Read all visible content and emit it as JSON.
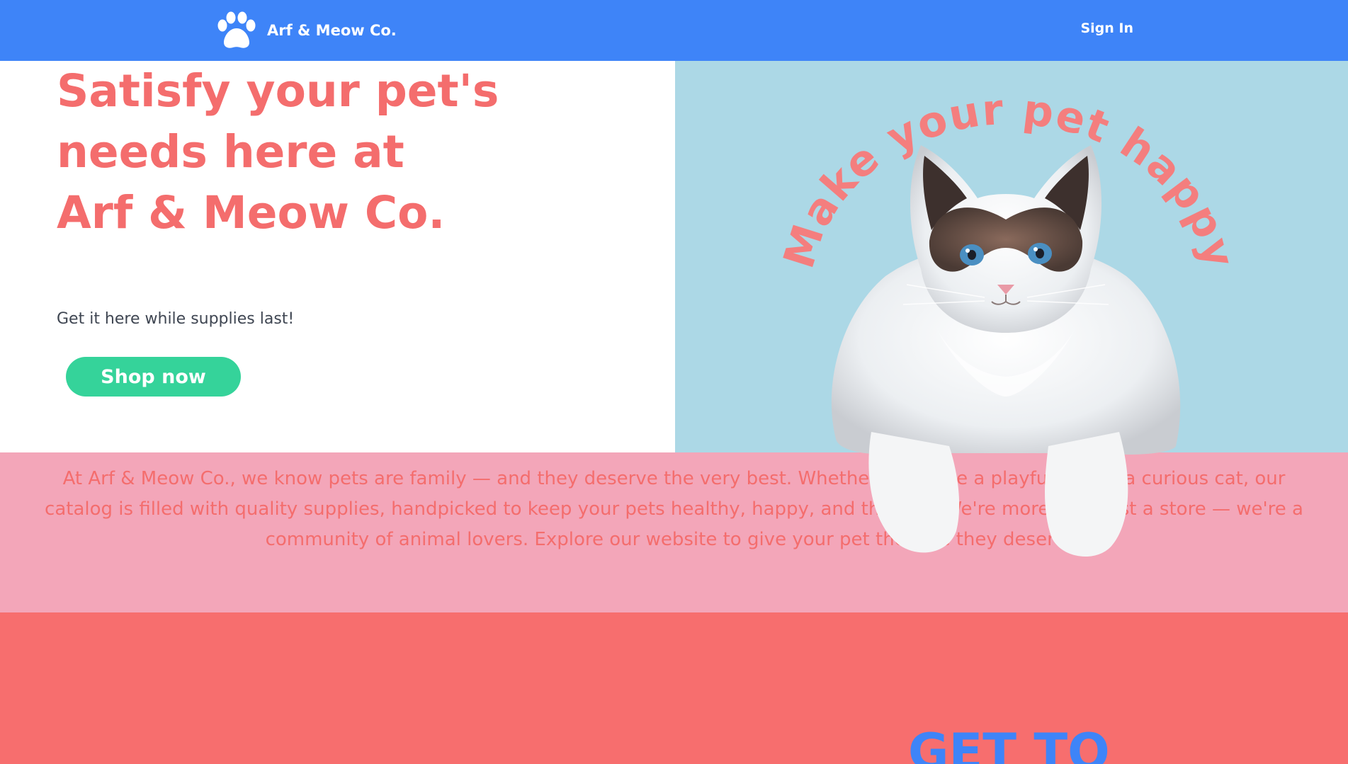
{
  "header": {
    "brand_name": "Arf & Meow Co.",
    "sign_in_label": "Sign In",
    "logo_icon": "paw-icon"
  },
  "hero": {
    "title_line1": "Satisfy your pet's",
    "title_line2": "needs here at",
    "title_line3": "Arf & Meow Co.",
    "subtitle": "Get it here while supplies last!",
    "cta_label": "Shop now",
    "arc_text": "Make your pet happy"
  },
  "about": {
    "text": "At Arf & Meow Co., we know pets are family — and they deserve the very best. Whether you have a playful pup or a curious cat, our catalog is filled with quality supplies, handpicked to keep your pets healthy, happy, and thriving. We're more than just a store — we're a community of animal lovers. Explore our website to give your pet the love they deserve."
  },
  "next_section": {
    "heading": "GET TO"
  },
  "colors": {
    "navbar": "#3e84f8",
    "accent_coral": "#f46d6d",
    "cta_green": "#35d39a",
    "hero_right_bg": "#acd8e6",
    "about_bg": "#f3a6b9",
    "bottom_bg": "#f76e6e"
  }
}
